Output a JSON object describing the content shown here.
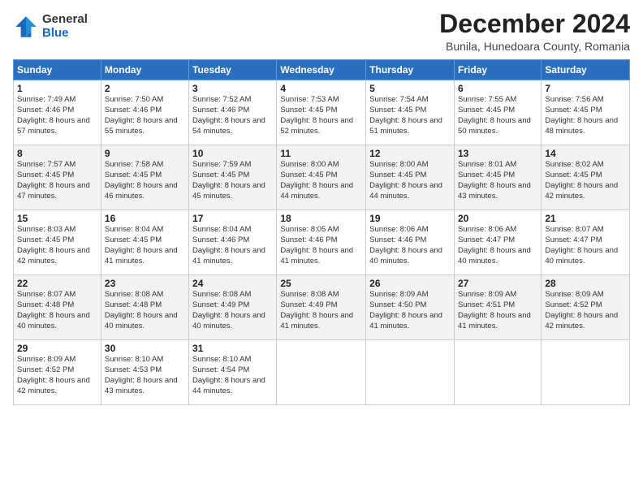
{
  "logo": {
    "general": "General",
    "blue": "Blue"
  },
  "header": {
    "month": "December 2024",
    "location": "Bunila, Hunedoara County, Romania"
  },
  "days_of_week": [
    "Sunday",
    "Monday",
    "Tuesday",
    "Wednesday",
    "Thursday",
    "Friday",
    "Saturday"
  ],
  "weeks": [
    [
      {
        "day": "1",
        "sunrise": "Sunrise: 7:49 AM",
        "sunset": "Sunset: 4:46 PM",
        "daylight": "Daylight: 8 hours and 57 minutes."
      },
      {
        "day": "2",
        "sunrise": "Sunrise: 7:50 AM",
        "sunset": "Sunset: 4:46 PM",
        "daylight": "Daylight: 8 hours and 55 minutes."
      },
      {
        "day": "3",
        "sunrise": "Sunrise: 7:52 AM",
        "sunset": "Sunset: 4:46 PM",
        "daylight": "Daylight: 8 hours and 54 minutes."
      },
      {
        "day": "4",
        "sunrise": "Sunrise: 7:53 AM",
        "sunset": "Sunset: 4:45 PM",
        "daylight": "Daylight: 8 hours and 52 minutes."
      },
      {
        "day": "5",
        "sunrise": "Sunrise: 7:54 AM",
        "sunset": "Sunset: 4:45 PM",
        "daylight": "Daylight: 8 hours and 51 minutes."
      },
      {
        "day": "6",
        "sunrise": "Sunrise: 7:55 AM",
        "sunset": "Sunset: 4:45 PM",
        "daylight": "Daylight: 8 hours and 50 minutes."
      },
      {
        "day": "7",
        "sunrise": "Sunrise: 7:56 AM",
        "sunset": "Sunset: 4:45 PM",
        "daylight": "Daylight: 8 hours and 48 minutes."
      }
    ],
    [
      {
        "day": "8",
        "sunrise": "Sunrise: 7:57 AM",
        "sunset": "Sunset: 4:45 PM",
        "daylight": "Daylight: 8 hours and 47 minutes."
      },
      {
        "day": "9",
        "sunrise": "Sunrise: 7:58 AM",
        "sunset": "Sunset: 4:45 PM",
        "daylight": "Daylight: 8 hours and 46 minutes."
      },
      {
        "day": "10",
        "sunrise": "Sunrise: 7:59 AM",
        "sunset": "Sunset: 4:45 PM",
        "daylight": "Daylight: 8 hours and 45 minutes."
      },
      {
        "day": "11",
        "sunrise": "Sunrise: 8:00 AM",
        "sunset": "Sunset: 4:45 PM",
        "daylight": "Daylight: 8 hours and 44 minutes."
      },
      {
        "day": "12",
        "sunrise": "Sunrise: 8:00 AM",
        "sunset": "Sunset: 4:45 PM",
        "daylight": "Daylight: 8 hours and 44 minutes."
      },
      {
        "day": "13",
        "sunrise": "Sunrise: 8:01 AM",
        "sunset": "Sunset: 4:45 PM",
        "daylight": "Daylight: 8 hours and 43 minutes."
      },
      {
        "day": "14",
        "sunrise": "Sunrise: 8:02 AM",
        "sunset": "Sunset: 4:45 PM",
        "daylight": "Daylight: 8 hours and 42 minutes."
      }
    ],
    [
      {
        "day": "15",
        "sunrise": "Sunrise: 8:03 AM",
        "sunset": "Sunset: 4:45 PM",
        "daylight": "Daylight: 8 hours and 42 minutes."
      },
      {
        "day": "16",
        "sunrise": "Sunrise: 8:04 AM",
        "sunset": "Sunset: 4:45 PM",
        "daylight": "Daylight: 8 hours and 41 minutes."
      },
      {
        "day": "17",
        "sunrise": "Sunrise: 8:04 AM",
        "sunset": "Sunset: 4:46 PM",
        "daylight": "Daylight: 8 hours and 41 minutes."
      },
      {
        "day": "18",
        "sunrise": "Sunrise: 8:05 AM",
        "sunset": "Sunset: 4:46 PM",
        "daylight": "Daylight: 8 hours and 41 minutes."
      },
      {
        "day": "19",
        "sunrise": "Sunrise: 8:06 AM",
        "sunset": "Sunset: 4:46 PM",
        "daylight": "Daylight: 8 hours and 40 minutes."
      },
      {
        "day": "20",
        "sunrise": "Sunrise: 8:06 AM",
        "sunset": "Sunset: 4:47 PM",
        "daylight": "Daylight: 8 hours and 40 minutes."
      },
      {
        "day": "21",
        "sunrise": "Sunrise: 8:07 AM",
        "sunset": "Sunset: 4:47 PM",
        "daylight": "Daylight: 8 hours and 40 minutes."
      }
    ],
    [
      {
        "day": "22",
        "sunrise": "Sunrise: 8:07 AM",
        "sunset": "Sunset: 4:48 PM",
        "daylight": "Daylight: 8 hours and 40 minutes."
      },
      {
        "day": "23",
        "sunrise": "Sunrise: 8:08 AM",
        "sunset": "Sunset: 4:48 PM",
        "daylight": "Daylight: 8 hours and 40 minutes."
      },
      {
        "day": "24",
        "sunrise": "Sunrise: 8:08 AM",
        "sunset": "Sunset: 4:49 PM",
        "daylight": "Daylight: 8 hours and 40 minutes."
      },
      {
        "day": "25",
        "sunrise": "Sunrise: 8:08 AM",
        "sunset": "Sunset: 4:49 PM",
        "daylight": "Daylight: 8 hours and 41 minutes."
      },
      {
        "day": "26",
        "sunrise": "Sunrise: 8:09 AM",
        "sunset": "Sunset: 4:50 PM",
        "daylight": "Daylight: 8 hours and 41 minutes."
      },
      {
        "day": "27",
        "sunrise": "Sunrise: 8:09 AM",
        "sunset": "Sunset: 4:51 PM",
        "daylight": "Daylight: 8 hours and 41 minutes."
      },
      {
        "day": "28",
        "sunrise": "Sunrise: 8:09 AM",
        "sunset": "Sunset: 4:52 PM",
        "daylight": "Daylight: 8 hours and 42 minutes."
      }
    ],
    [
      {
        "day": "29",
        "sunrise": "Sunrise: 8:09 AM",
        "sunset": "Sunset: 4:52 PM",
        "daylight": "Daylight: 8 hours and 42 minutes."
      },
      {
        "day": "30",
        "sunrise": "Sunrise: 8:10 AM",
        "sunset": "Sunset: 4:53 PM",
        "daylight": "Daylight: 8 hours and 43 minutes."
      },
      {
        "day": "31",
        "sunrise": "Sunrise: 8:10 AM",
        "sunset": "Sunset: 4:54 PM",
        "daylight": "Daylight: 8 hours and 44 minutes."
      },
      null,
      null,
      null,
      null
    ]
  ]
}
